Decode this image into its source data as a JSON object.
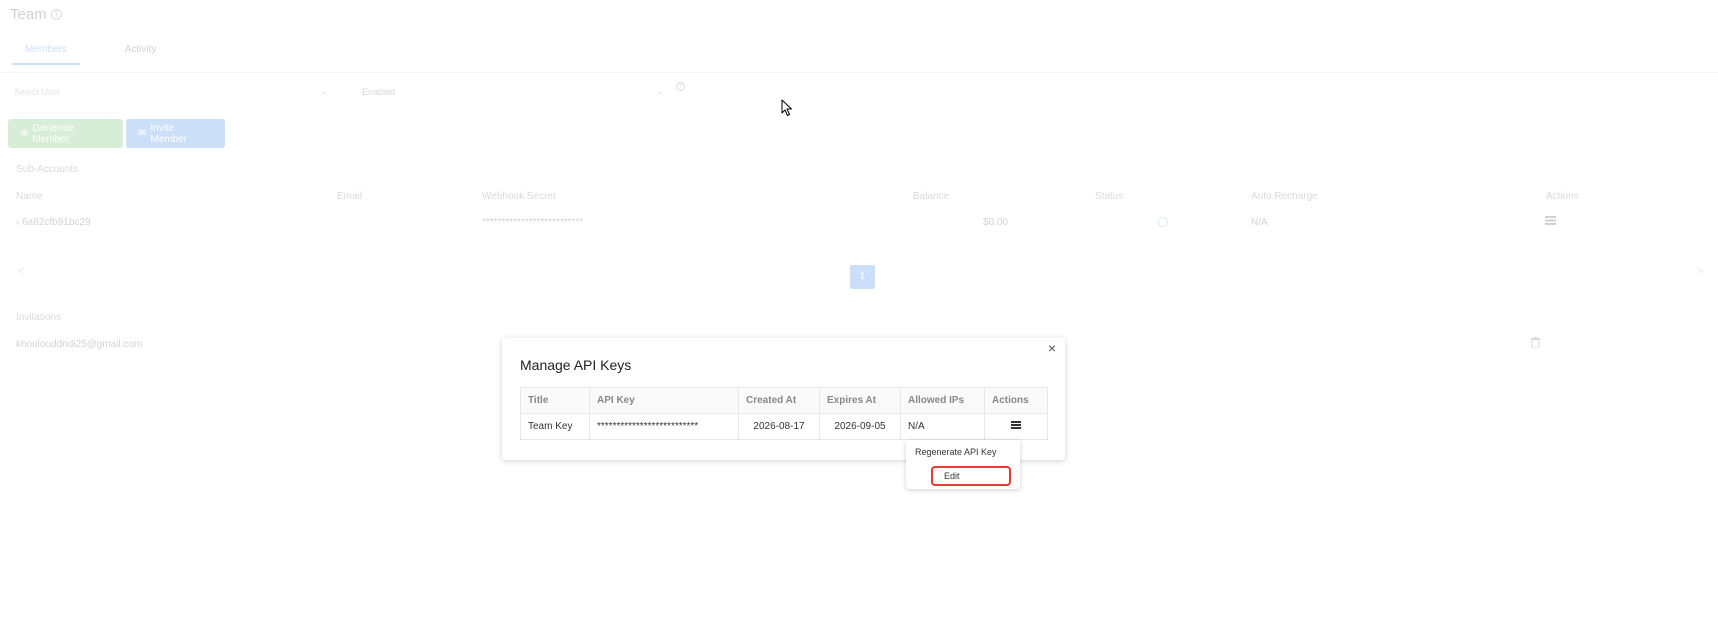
{
  "page": {
    "title": "Team",
    "tabs": [
      {
        "label": "Members",
        "active": true
      },
      {
        "label": "Activity",
        "active": false
      }
    ],
    "filters": {
      "user_placeholder": "Select User",
      "status_value": "Enabled"
    },
    "buttons": {
      "generate": "Generate Member",
      "invite": "Invite Member"
    },
    "sub_accounts": {
      "title": "Sub-Accounts",
      "columns": [
        "Name",
        "Email",
        "Webhook Secret",
        "Balance",
        "Status",
        "Auto Recharge",
        "Actions"
      ],
      "row": {
        "name": "6a82cfb91bc29",
        "email": "",
        "webhook_secret": "**************************",
        "balance": "$0.00",
        "auto_recharge": "N/A"
      }
    },
    "pagination": {
      "prev": "<",
      "current": "1",
      "next": ">"
    },
    "invitations": {
      "title": "Invitations",
      "email": "khoulouddridi25@gmail.com"
    }
  },
  "modal": {
    "title": "Manage API Keys",
    "close": "×",
    "columns": [
      "Title",
      "API Key",
      "Created At",
      "Expires At",
      "Allowed IPs",
      "Actions"
    ],
    "rows": [
      {
        "title": "Team Key",
        "api_key": "**************************",
        "created_at": "2026-08-17",
        "expires_at": "2026-09-05",
        "allowed_ips": "N/A"
      }
    ]
  },
  "dropdown": {
    "regenerate": "Regenerate API Key",
    "edit": "Edit"
  },
  "colors": {
    "primary": "#1a73e8",
    "success": "#4caf50",
    "highlight": "#e53935"
  },
  "icons": {
    "help": "help-circle-icon",
    "close": "close-icon",
    "actions": "list-icon",
    "delete": "trash-icon",
    "cursor": "mouse-pointer-icon"
  }
}
